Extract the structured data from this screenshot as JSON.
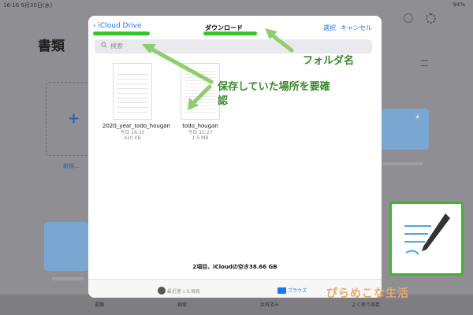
{
  "status": {
    "time": "16:16",
    "date": "9月30日(水)",
    "battery": "94%"
  },
  "background": {
    "title": "書類",
    "new_label": "新規...",
    "tabs": [
      "書類",
      "検索",
      "共有済み",
      "よく使う項目"
    ]
  },
  "modal": {
    "back_label": "iCloud Drive",
    "folder_title": "ダウンロード",
    "select_label": "選択",
    "cancel_label": "キャンセル",
    "search_placeholder": "検索",
    "files": [
      {
        "name": "2020_year_todo_hougan",
        "date": "今日 16:15",
        "size": "420 KB"
      },
      {
        "name": "todo_hougan",
        "date": "今日 15:27",
        "size": "1.5 MB"
      }
    ],
    "footer": "2項目、iCloudの空き38.66 GB",
    "tabs": [
      {
        "label": "最近使った項目",
        "active": false
      },
      {
        "label": "ブラウズ",
        "active": true
      }
    ]
  },
  "annotations": {
    "folder_name": "フォルダ名",
    "saved_location": "保存していた場所を要確認"
  },
  "brand": "ぴらめこな生活",
  "colors": {
    "ios_blue": "#1877f2",
    "annotation_green": "#3fb52c"
  }
}
